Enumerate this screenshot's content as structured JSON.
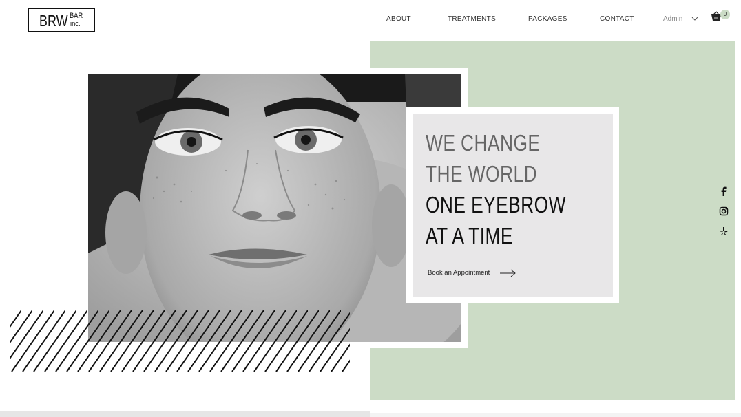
{
  "brand": {
    "main": "BRW",
    "top": "BAR",
    "bottom": "inc."
  },
  "nav": {
    "about": "ABOUT",
    "treatments": "TREATMENTS",
    "packages": "PACKAGES",
    "contact": "CONTACT"
  },
  "account": {
    "label": "Admin"
  },
  "cart": {
    "count": "0"
  },
  "hero": {
    "line1": "WE CHANGE",
    "line2": "THE WORLD",
    "line3": "ONE EYEBROW",
    "line4": "AT A TIME",
    "cta": "Book an Appointment"
  },
  "social": [
    "facebook-icon",
    "instagram-icon",
    "yelp-icon"
  ],
  "colors": {
    "accent_green": "#ccdcc6",
    "card_bg": "#e8e7e8",
    "text_dark": "#111111",
    "text_gray": "#666666"
  }
}
